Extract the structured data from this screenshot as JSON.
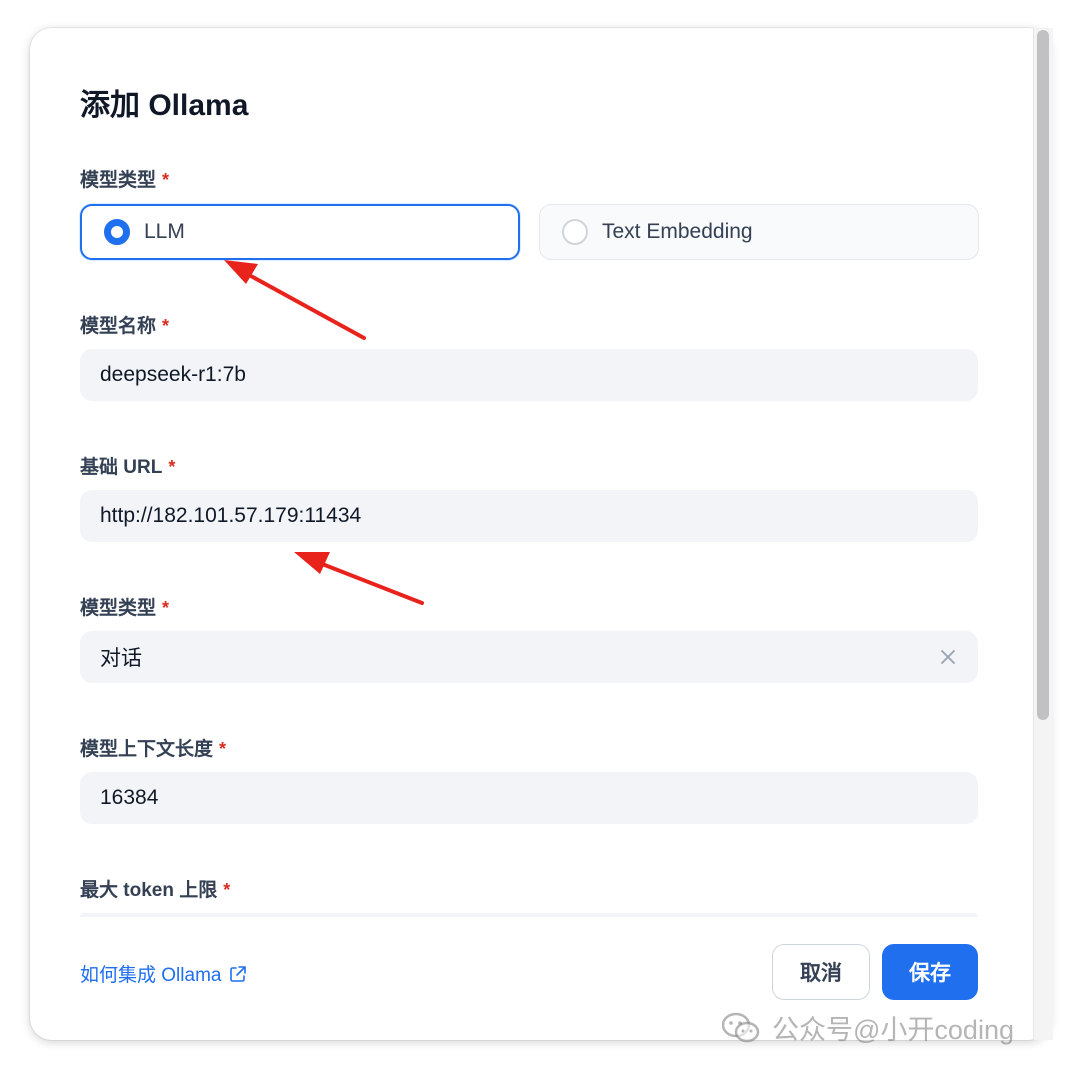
{
  "dialog": {
    "title": "添加 Ollama"
  },
  "fields": {
    "model_kind": {
      "label": "模型类型",
      "required": "*",
      "options": [
        {
          "label": "LLM",
          "selected": true
        },
        {
          "label": "Text Embedding",
          "selected": false
        }
      ]
    },
    "model_name": {
      "label": "模型名称",
      "required": "*",
      "value": "deepseek-r1:7b"
    },
    "base_url": {
      "label": "基础 URL",
      "required": "*",
      "value": "http://182.101.57.179:11434"
    },
    "model_type": {
      "label": "模型类型",
      "required": "*",
      "value": "对话",
      "clear_icon": "close-icon"
    },
    "context_length": {
      "label": "模型上下文长度",
      "required": "*",
      "value": "16384"
    },
    "max_tokens": {
      "label": "最大 token 上限",
      "required": "*"
    }
  },
  "footer": {
    "help_link": "如何集成 Ollama",
    "help_icon": "external-link-icon",
    "cancel_label": "取消",
    "save_label": "保存"
  },
  "watermark": {
    "text": "公众号@小开coding",
    "icon": "wechat-icon"
  },
  "colors": {
    "accent": "#1f6fef",
    "required": "#d92d20",
    "annotation_arrow": "#e8231c"
  }
}
